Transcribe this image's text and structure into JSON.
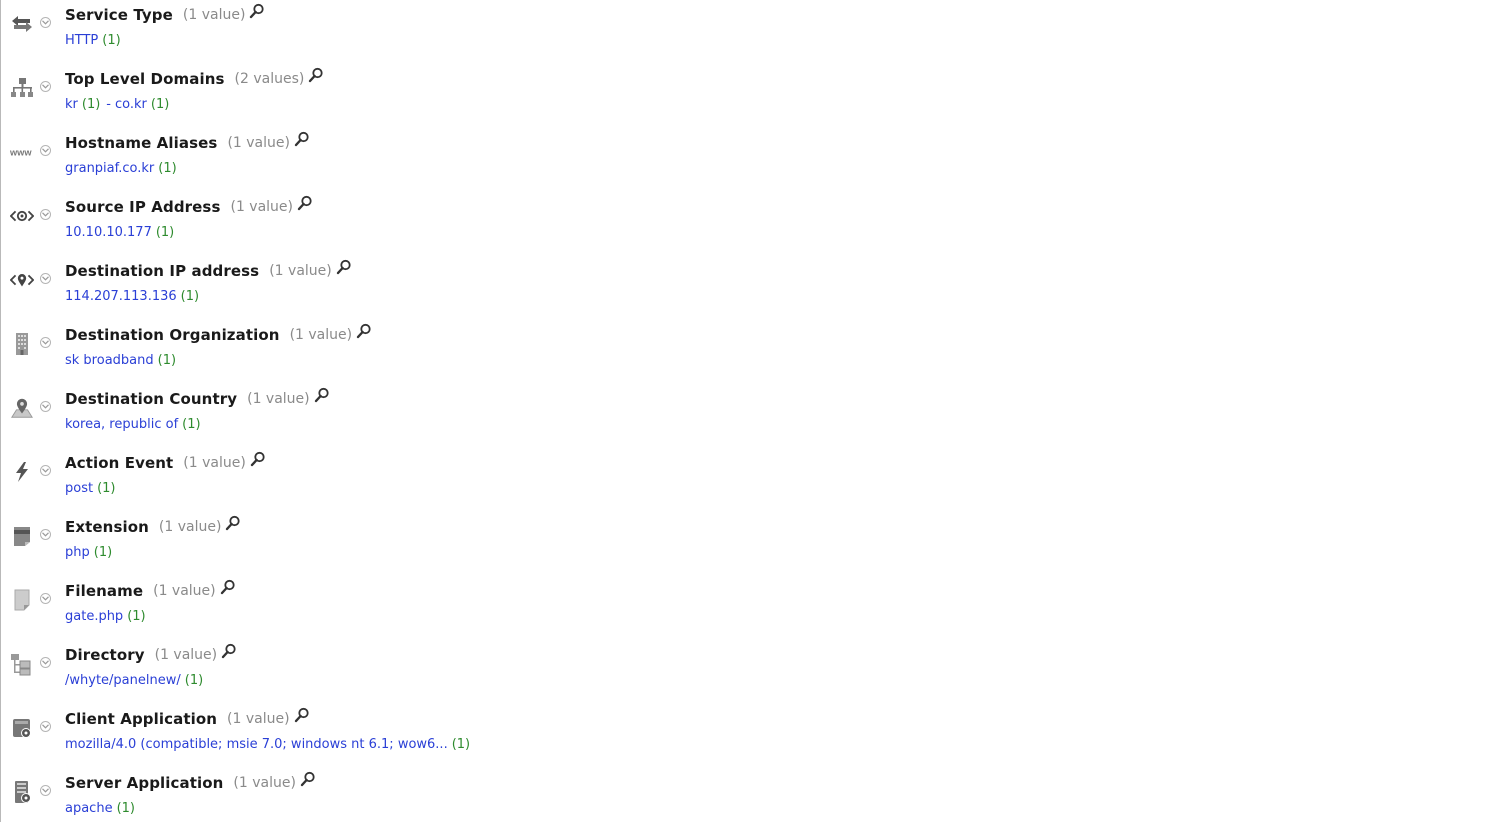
{
  "rows": [
    {
      "icon": "exchange-arrows-icon",
      "title": "Service Type",
      "count": "(1 value)",
      "values": [
        {
          "text": "HTTP",
          "count": "(1)"
        }
      ]
    },
    {
      "icon": "network-tree-icon",
      "title": "Top Level Domains",
      "count": "(2 values)",
      "values": [
        {
          "text": "kr",
          "count": "(1)"
        },
        {
          "text": "co.kr",
          "count": "(1)"
        }
      ],
      "separator": "-"
    },
    {
      "icon": "www-icon",
      "title": "Hostname Aliases",
      "count": "(1 value)",
      "values": [
        {
          "text": "granpiaf.co.kr",
          "count": "(1)"
        }
      ]
    },
    {
      "icon": "source-ip-icon",
      "title": "Source IP Address",
      "count": "(1 value)",
      "values": [
        {
          "text": "10.10.10.177",
          "count": "(1)"
        }
      ]
    },
    {
      "icon": "destination-ip-icon",
      "title": "Destination IP address",
      "count": "(1 value)",
      "values": [
        {
          "text": "114.207.113.136",
          "count": "(1)"
        }
      ]
    },
    {
      "icon": "building-icon",
      "title": "Destination Organization",
      "count": "(1 value)",
      "values": [
        {
          "text": "sk broadband",
          "count": "(1)"
        }
      ]
    },
    {
      "icon": "map-pin-icon",
      "title": "Destination Country",
      "count": "(1 value)",
      "values": [
        {
          "text": "korea, republic of",
          "count": "(1)"
        }
      ]
    },
    {
      "icon": "lightning-icon",
      "title": "Action Event",
      "count": "(1 value)",
      "values": [
        {
          "text": "post",
          "count": "(1)"
        }
      ]
    },
    {
      "icon": "file-extension-icon",
      "title": "Extension",
      "count": "(1 value)",
      "values": [
        {
          "text": "php",
          "count": "(1)"
        }
      ]
    },
    {
      "icon": "file-icon",
      "title": "Filename",
      "count": "(1 value)",
      "values": [
        {
          "text": "gate.php",
          "count": "(1)"
        }
      ]
    },
    {
      "icon": "directory-tree-icon",
      "title": "Directory",
      "count": "(1 value)",
      "values": [
        {
          "text": "/whyte/panelnew/",
          "count": "(1)"
        }
      ]
    },
    {
      "icon": "client-application-icon",
      "title": "Client Application",
      "count": "(1 value)",
      "values": [
        {
          "text": "mozilla/4.0 (compatible; msie 7.0; windows nt 6.1; wow6...",
          "count": "(1)"
        }
      ]
    },
    {
      "icon": "server-application-icon",
      "title": "Server Application",
      "count": "(1 value)",
      "values": [
        {
          "text": "apache",
          "count": "(1)"
        }
      ]
    }
  ]
}
